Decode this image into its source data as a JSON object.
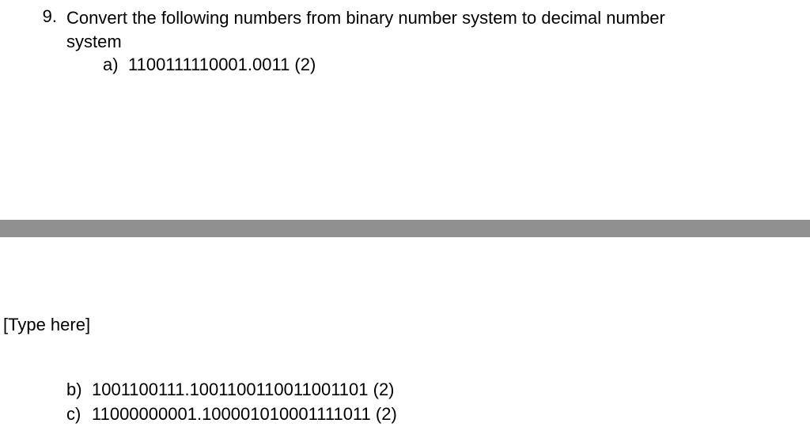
{
  "question": {
    "number": "9.",
    "prompt_line1": "Convert the following numbers from binary number system to decimal number",
    "prompt_line2": "system",
    "items": [
      {
        "label": "a)",
        "value": "1100111110001.0011 (2)"
      },
      {
        "label": "b)",
        "value": "1001100111.1001100110011001101 (2)"
      },
      {
        "label": "c)",
        "value": "11000000001.100001010001111011 (2)"
      }
    ]
  },
  "placeholder": "[Type here]"
}
